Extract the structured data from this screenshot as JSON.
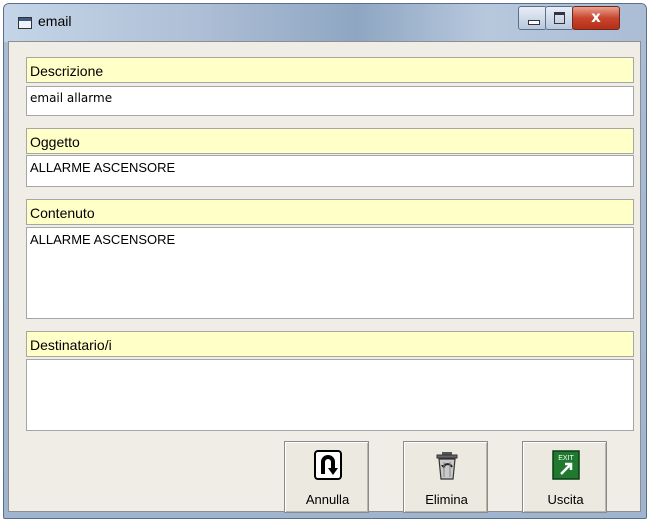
{
  "window": {
    "title": "email"
  },
  "titlebar_buttons": {
    "close_glyph": "x"
  },
  "fields": {
    "descrizione": {
      "label": "Descrizione",
      "value": "email allarme"
    },
    "oggetto": {
      "label": "Oggetto",
      "value": "ALLARME ASCENSORE"
    },
    "contenuto": {
      "label": "Contenuto",
      "value": "ALLARME ASCENSORE"
    },
    "destinatari": {
      "label": "Destinatario/i",
      "value": ""
    }
  },
  "buttons": {
    "annulla": {
      "label": "Annulla",
      "icon": "u-turn-icon"
    },
    "elimina": {
      "label": "Elimina",
      "icon": "trash-icon"
    },
    "uscita": {
      "label": "Uscita",
      "icon": "exit-icon",
      "icon_text": "EXIT"
    }
  }
}
